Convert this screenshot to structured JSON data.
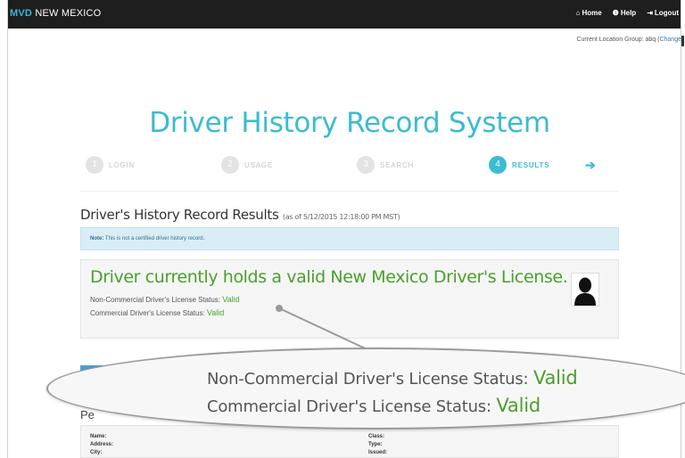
{
  "header": {
    "brand_prefix": "MVD",
    "brand_suffix": "NEW MEXICO",
    "links": [
      {
        "icon": "home-icon",
        "glyph": "⌂",
        "label": "Home"
      },
      {
        "icon": "help-icon",
        "glyph": "❶",
        "label": "Help"
      },
      {
        "icon": "logout-icon",
        "glyph": "⇥",
        "label": "Logout"
      }
    ]
  },
  "location": {
    "text": "Current Location Group: abq (",
    "change_label": "Change"
  },
  "page_title": "Driver History Record System",
  "steps": [
    {
      "num": "1",
      "label": "LOGIN",
      "active": false
    },
    {
      "num": "2",
      "label": "USAGE",
      "active": false
    },
    {
      "num": "3",
      "label": "SEARCH",
      "active": false
    },
    {
      "num": "4",
      "label": "RESULTS",
      "active": true
    }
  ],
  "next_arrow": "➔",
  "results": {
    "heading": "Driver's History Record Results",
    "as_of": "(as of 5/12/2015 12:18:00 PM MST)",
    "note_label": "Note:",
    "note_text": "This is not a certified driver history record."
  },
  "status": {
    "headline": "Driver currently holds a valid New Mexico Driver's License.",
    "non_commercial_label": "Non-Commercial Driver's License Status:",
    "non_commercial_value": "Valid",
    "commercial_label": "Commercial Driver's License Status:",
    "commercial_value": "Valid"
  },
  "section_partial": "Pe",
  "fields_left": [
    "Name:",
    "Address:",
    "City:"
  ],
  "fields_right": [
    "Class:",
    "Type:",
    "Issued:"
  ],
  "zoom": {
    "non_commercial_label": "Non-Commercial Driver's License Status:",
    "non_commercial_value": "Valid",
    "commercial_label": "Commercial Driver's License Status:",
    "commercial_value": "Valid"
  },
  "colors": {
    "brand_blue": "#3ab4d6",
    "accent_teal": "#3bbcd0",
    "valid_green": "#4aa02c",
    "navbar_bg": "#1e1e1e"
  }
}
